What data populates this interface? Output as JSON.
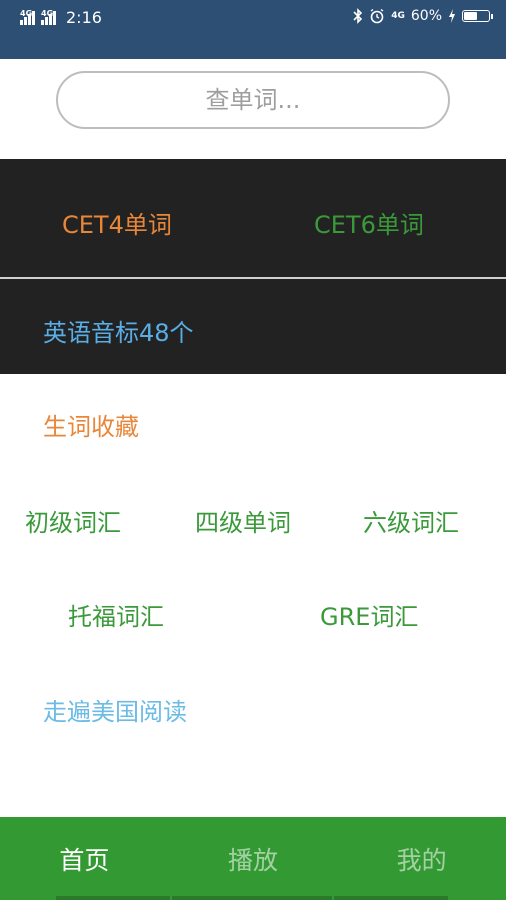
{
  "status_bar": {
    "signal1": "4G",
    "signal2": "4G",
    "time": "2:16",
    "network": "4G",
    "battery_percent": "60%",
    "battery_level": 0.6,
    "icons": [
      "bluetooth-icon",
      "alarm-icon",
      "charging-icon"
    ]
  },
  "search": {
    "placeholder": "查单词..."
  },
  "categories": {
    "cet4": "CET4单词",
    "cet6": "CET6单词",
    "phonetics": "英语音标48个",
    "favorites": "生词收藏",
    "beginner": "初级词汇",
    "level4": "四级单词",
    "level6": "六级词汇",
    "toefl": "托福词汇",
    "gre": "GRE词汇",
    "reading": "走遍美国阅读"
  },
  "tabs": [
    {
      "label": "首页",
      "active": true
    },
    {
      "label": "播放",
      "active": false
    },
    {
      "label": "我的",
      "active": false
    }
  ],
  "colors": {
    "status_bar": "#2e4f74",
    "dark_row": "#222222",
    "orange": "#e8873a",
    "green": "#3a9a3a",
    "blue": "#5aaee6",
    "tab_bar": "#339933"
  }
}
